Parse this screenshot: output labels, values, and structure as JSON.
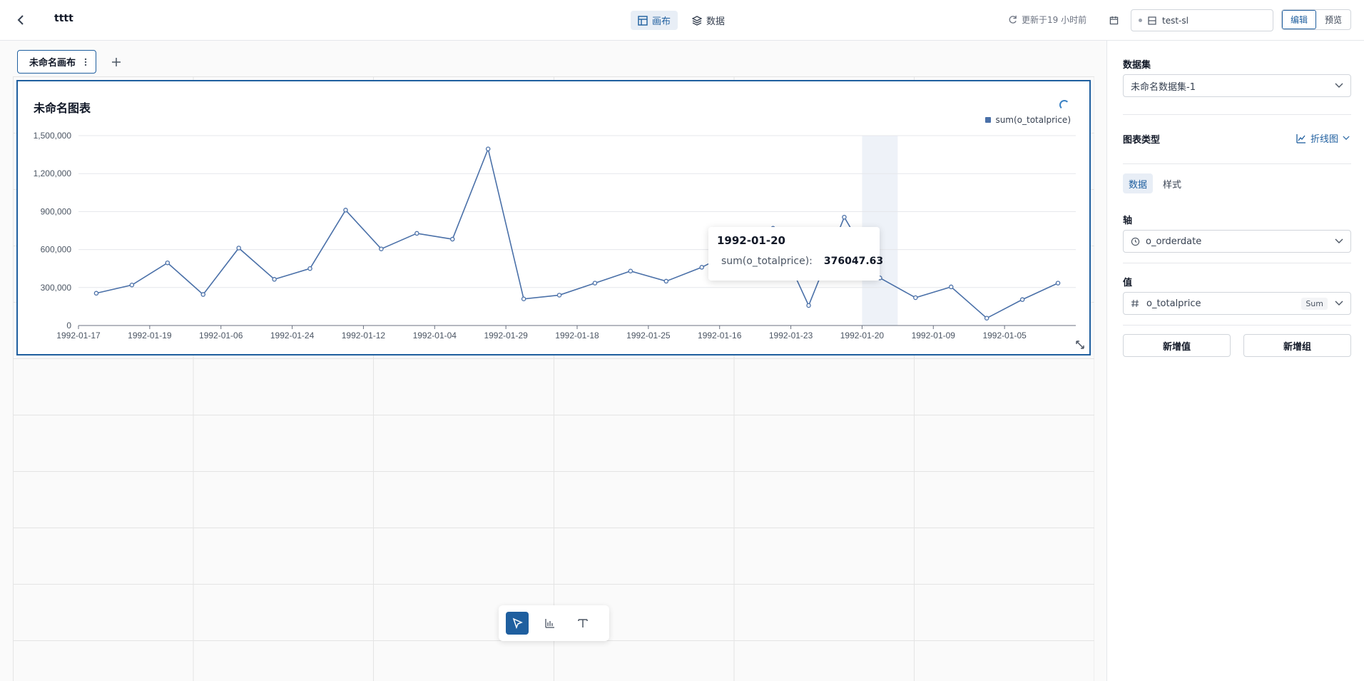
{
  "header": {
    "title": "tttt",
    "tabs": [
      {
        "label": "画布",
        "icon": "layout-icon",
        "active": true
      },
      {
        "label": "数据",
        "icon": "layers-icon",
        "active": false
      }
    ],
    "update_text": "更新于19 小时前",
    "database": "test-sl",
    "modes": {
      "edit": "编辑",
      "preview": "预览"
    }
  },
  "canvas": {
    "tab_name": "未命名画布"
  },
  "chart_card": {
    "title": "未命名图表",
    "legend": "sum(o_totalprice)",
    "tooltip": {
      "date": "1992-01-20",
      "series": "sum(o_totalprice):",
      "value": "376047.63"
    }
  },
  "chart_data": {
    "type": "line",
    "series_color": "#4a70a8",
    "ylim": [
      0,
      1500000
    ],
    "y_ticks": [
      "0",
      "300,000",
      "600,000",
      "900,000",
      "1,200,000",
      "1,500,000"
    ],
    "x_tick_labels": [
      "1992-01-17",
      "1992-01-19",
      "1992-01-06",
      "1992-01-24",
      "1992-01-12",
      "1992-01-04",
      "1992-01-29",
      "1992-01-18",
      "1992-01-25",
      "1992-01-16",
      "1992-01-23",
      "1992-01-20",
      "1992-01-09",
      "1992-01-05"
    ],
    "highlight_index": 22,
    "series": [
      {
        "name": "sum(o_totalprice)",
        "values": [
          255000,
          320000,
          495000,
          245000,
          612000,
          365000,
          450000,
          912000,
          605000,
          728000,
          682000,
          1395000,
          210000,
          240000,
          335000,
          430000,
          350000,
          460000,
          602000,
          768000,
          158000,
          856000,
          376047.63,
          220000,
          305000,
          58000,
          205000,
          335000
        ]
      }
    ]
  },
  "toolbar": {
    "tools": [
      "cursor-icon",
      "chart-icon",
      "text-icon"
    ]
  },
  "right_panel": {
    "dataset_label": "数据集",
    "dataset_value": "未命名数据集-1",
    "chart_type_label": "图表类型",
    "chart_type_value": "折线图",
    "sub_tabs": {
      "data": "数据",
      "style": "样式"
    },
    "axis_label": "轴",
    "axis_value": "o_orderdate",
    "value_label": "值",
    "value_field": "o_totalprice",
    "aggregation": "Sum",
    "add_value": "新增值",
    "add_group": "新增组"
  }
}
